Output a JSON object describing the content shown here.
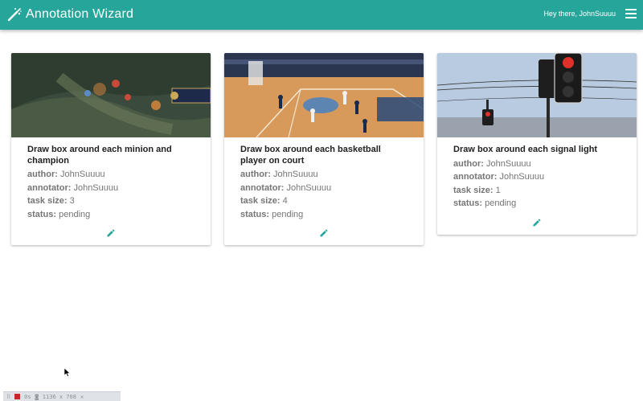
{
  "app": {
    "title": "Annotation Wizard",
    "greeting": "Hey there, JohnSuuuu"
  },
  "icons": {
    "brand": "wand-icon",
    "menu": "hamburger-menu-icon",
    "edit": "pencil-icon",
    "accent": "#26a69a"
  },
  "labels": {
    "author": "author:",
    "annotator": "annotator:",
    "task_size": "task size:",
    "status": "status:"
  },
  "cards": [
    {
      "title": "Draw box around each minion and champion",
      "author": "JohnSuuuu",
      "annotator": "JohnSuuuu",
      "task_size": "3",
      "status": "pending"
    },
    {
      "title": "Draw box around each basketball player on court",
      "author": "JohnSuuuu",
      "annotator": "JohnSuuuu",
      "task_size": "4",
      "status": "pending"
    },
    {
      "title": "Draw box around each signal light",
      "author": "JohnSuuuu",
      "annotator": "JohnSuuuu",
      "task_size": "1",
      "status": "pending"
    }
  ],
  "devtools": {
    "timer": "0s",
    "size": "1136 x 708"
  }
}
